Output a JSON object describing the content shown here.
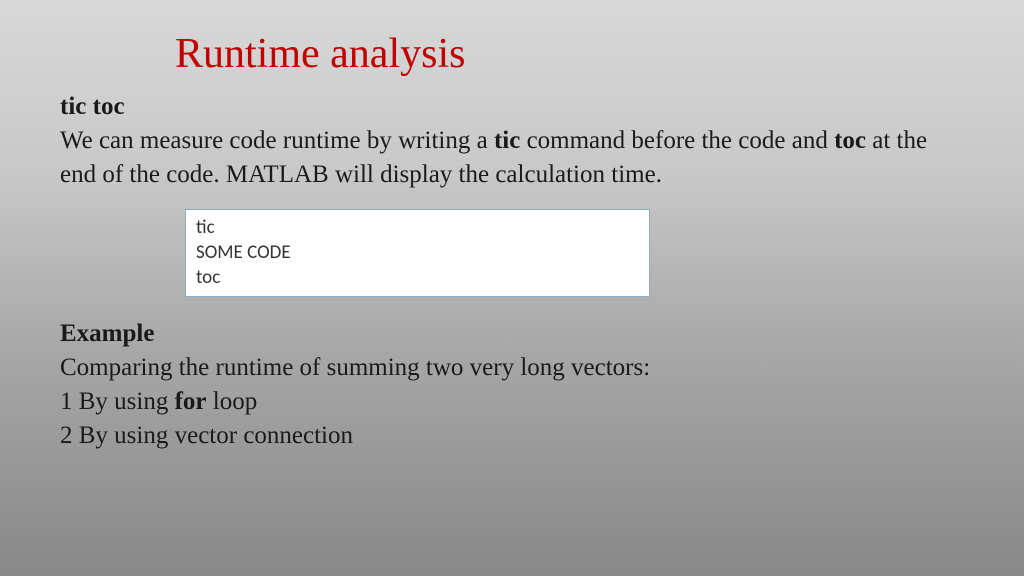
{
  "title": "Runtime analysis",
  "section": {
    "heading": "tic toc",
    "body_before_tic": "We can measure code runtime by writing a ",
    "tic_word": "tic",
    "body_mid": " command before the code and ",
    "toc_word": "toc",
    "body_after_toc": " at the end of the code. MATLAB will display the calculation time."
  },
  "code": {
    "line1": "tic",
    "line2": "SOME CODE",
    "line3": "toc"
  },
  "example": {
    "heading": "Example",
    "desc": "Comparing the runtime of summing two very long vectors:",
    "item1_prefix": "1 By using ",
    "item1_bold": "for",
    "item1_suffix": " loop",
    "item2": "2 By using vector connection"
  }
}
